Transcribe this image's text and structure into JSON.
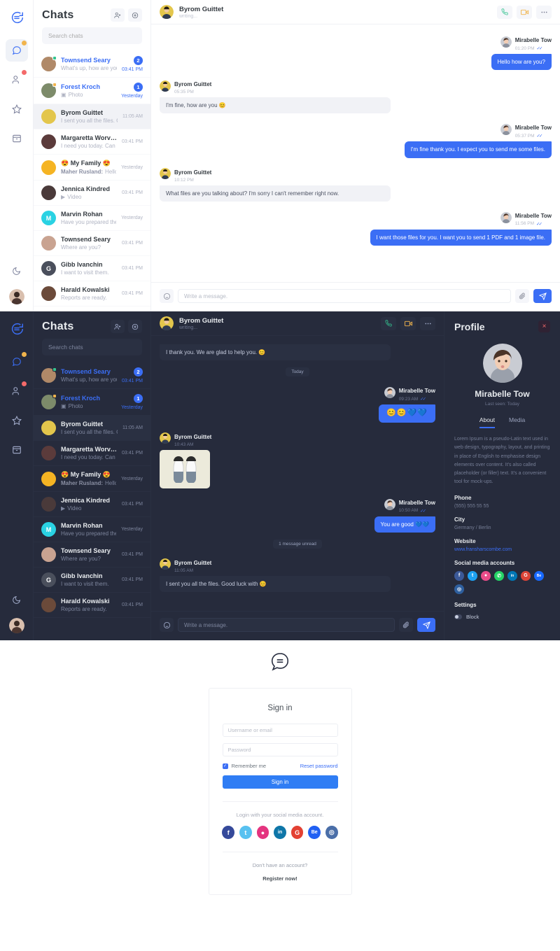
{
  "brand": {
    "accent": "#3b6ef5",
    "green": "#34c38f",
    "amber": "#f1b44c",
    "red": "#f46a6a"
  },
  "rail": {
    "items": [
      {
        "icon": "chat-logo-icon",
        "name": "app-logo"
      },
      {
        "icon": "chat-icon",
        "name": "rail-item-chats",
        "badge": "#f1b44c",
        "active": true
      },
      {
        "icon": "contacts-icon",
        "name": "rail-item-contacts",
        "badge": "#f46a6a",
        "active": false
      },
      {
        "icon": "star-icon",
        "name": "rail-item-favorites",
        "badge": "",
        "active": false
      },
      {
        "icon": "archive-icon",
        "name": "rail-item-archive",
        "badge": "",
        "active": false
      }
    ],
    "bottom": [
      {
        "icon": "moon-icon",
        "name": "rail-item-dark-mode"
      },
      {
        "icon": "avatar-icon",
        "name": "rail-item-profile"
      }
    ]
  },
  "list": {
    "title": "Chats",
    "action_add_label": "add-contact",
    "action_settings_label": "settings",
    "search_placeholder": "Search chats",
    "rows": [
      {
        "name": "Townsend Seary",
        "sub": "What's up, how are you?",
        "time": "03:41 PM",
        "badge": "2",
        "unread": true,
        "status": "#34c38f",
        "avatar": "#b08968",
        "initial": ""
      },
      {
        "name": "Forest Kroch",
        "sub": "Photo",
        "sub_icon": "camera-icon",
        "time": "Yesterday",
        "badge": "1",
        "unread": true,
        "status": "#f1b44c",
        "avatar": "#7d8b6a",
        "initial": ""
      },
      {
        "name": "Byrom Guittet",
        "sub": "I sent you all the files. G...",
        "time": "11:05 AM",
        "badge": "",
        "unread": false,
        "status": "",
        "avatar": "#e3c64c",
        "initial": "",
        "active": true
      },
      {
        "name": "Margaretta Worvell",
        "sub": "I need you today. Can y...",
        "time": "03:41 PM",
        "badge": "",
        "unread": false,
        "status": "",
        "avatar": "#5b3b3b",
        "initial": ""
      },
      {
        "name": "😍 My Family 😍",
        "sub_bold": "Maher Rusland:",
        "sub": "Hello!!!",
        "time": "Yesterday",
        "badge": "",
        "unread": false,
        "status": "",
        "avatar": "#f5b423",
        "initial": ""
      },
      {
        "name": "Jennica Kindred",
        "sub": "Video",
        "sub_icon": "video-icon",
        "time": "03:41 PM",
        "badge": "",
        "unread": false,
        "status": "",
        "avatar": "#4a3a3a",
        "initial": ""
      },
      {
        "name": "Marvin Rohan",
        "sub": "Have you prepared the ...",
        "time": "Yesterday",
        "badge": "",
        "unread": false,
        "status": "",
        "avatar": "#2ad2e3",
        "initial": "M"
      },
      {
        "name": "Townsend Seary",
        "sub": "Where are you?",
        "time": "03:41 PM",
        "badge": "",
        "unread": false,
        "status": "",
        "avatar": "#c9a391",
        "initial": ""
      },
      {
        "name": "Gibb Ivanchin",
        "sub": "I want to visit them.",
        "time": "03:41 PM",
        "badge": "",
        "unread": false,
        "status": "",
        "avatar": "#4a4f5c",
        "initial": "G"
      },
      {
        "name": "Harald Kowalski",
        "sub": "Reports are ready.",
        "time": "03:41 PM",
        "badge": "",
        "unread": false,
        "status": "",
        "avatar": "#6b4a3a",
        "initial": ""
      }
    ]
  },
  "convo_light": {
    "header": {
      "name": "Byrom Guittet",
      "state": "writing...",
      "call_label": "voice-call",
      "video_label": "video-call",
      "more_label": "more-options"
    },
    "messages": [
      {
        "dir": "out",
        "name": "Mirabelle Tow",
        "time": "01:20 PM",
        "ticks": "✓✓",
        "text": "Hello how are you?"
      },
      {
        "dir": "in",
        "name": "Byrom Guittet",
        "time": "05:35 PM",
        "text": "I'm fine, how are you 😊"
      },
      {
        "dir": "out",
        "name": "Mirabelle Tow",
        "time": "05:37 PM",
        "ticks": "✓✓",
        "text": "I'm fine thank you. I expect you to send me some files."
      },
      {
        "dir": "in",
        "name": "Byrom Guittet",
        "time": "10:12 PM",
        "text": "What files are you talking about? I'm sorry I can't remember right now."
      },
      {
        "dir": "out",
        "name": "Mirabelle Tow",
        "time": "11:56 PM",
        "ticks": "✓✓",
        "text": "I want those files for you. I want you to send 1 PDF and 1 image file."
      }
    ],
    "footer": {
      "emoji_label": "emoji-picker",
      "placeholder": "Write a message.",
      "attach_label": "attach-file",
      "send_label": "send-message"
    }
  },
  "convo_dark": {
    "header": {
      "name": "Byrom Guittet",
      "state": "writing...",
      "call_label": "voice-call",
      "video_label": "video-call",
      "more_label": "more-options"
    },
    "messages": [
      {
        "dir": "in",
        "text": "I thank you. We are glad to help you. 😊",
        "nometa": true
      },
      {
        "dir": "day",
        "text": "Today"
      },
      {
        "dir": "out",
        "name": "Mirabelle Tow",
        "time": "09:23 AM",
        "ticks": "✓✓",
        "text": "😊😊💙💙",
        "emoji": true
      },
      {
        "dir": "in",
        "name": "Byrom Guittet",
        "time": "10:43 AM",
        "image": true
      },
      {
        "dir": "out",
        "name": "Mirabelle Tow",
        "time": "10:50 AM",
        "ticks": "✓✓",
        "text": "You are good 💙💙"
      },
      {
        "dir": "day",
        "text": "1 message unread"
      },
      {
        "dir": "in",
        "name": "Byrom Guittet",
        "time": "11:05 AM",
        "text": "I sent you all the files. Good luck with 😊"
      }
    ],
    "footer": {
      "emoji_label": "emoji-picker",
      "placeholder": "Write a message.",
      "attach_label": "attach-file",
      "send_label": "send-message"
    }
  },
  "profile": {
    "title": "Profile",
    "close_label": "×",
    "name": "Mirabelle Tow",
    "last_seen": "Last seen: Today",
    "tabs": [
      {
        "label": "About",
        "active": true
      },
      {
        "label": "Media",
        "active": false
      }
    ],
    "about": "Lorem Ipsum is a pseudo-Latin text used in web design, typography, layout, and printing in place of English to emphasise design elements over content. It's also called placeholder (or filler) text. It's a convenient tool for mock-ups.",
    "phone_label": "Phone",
    "phone": "(555) 555 55 55",
    "city_label": "City",
    "city": "Germany / Berlin",
    "website_label": "Website",
    "website": "www.fransharscombe.com",
    "socials_label": "Social media accounts",
    "socials": [
      {
        "name": "facebook-icon",
        "glyph": "f",
        "color": "#3b5998"
      },
      {
        "name": "twitter-icon",
        "glyph": "t",
        "color": "#1da1f2"
      },
      {
        "name": "dribbble-icon",
        "glyph": "●",
        "color": "#ea4c89"
      },
      {
        "name": "whatsapp-icon",
        "glyph": "✆",
        "color": "#25d366"
      },
      {
        "name": "linkedin-icon",
        "glyph": "in",
        "color": "#0077b5"
      },
      {
        "name": "google-icon",
        "glyph": "G",
        "color": "#db4437"
      },
      {
        "name": "behance-icon",
        "glyph": "Be",
        "color": "#1769ff"
      },
      {
        "name": "instagram-icon",
        "glyph": "◎",
        "color": "#2e5f9e"
      }
    ],
    "settings_label": "Settings",
    "block_label": "Block"
  },
  "signin": {
    "logo_label": "chat-logo-icon",
    "title": "Sign in",
    "username_placeholder": "Username or email",
    "password_placeholder": "Password",
    "remember_label": "Remember me",
    "reset_label": "Reset password",
    "submit_label": "Sign in",
    "social_hint": "Login with your social media account.",
    "socials": [
      {
        "name": "facebook-icon",
        "glyph": "f",
        "color": "#35499a"
      },
      {
        "name": "twitter-icon",
        "glyph": "t",
        "color": "#58c1f0"
      },
      {
        "name": "dribbble-icon",
        "glyph": "●",
        "color": "#e4347f"
      },
      {
        "name": "linkedin-icon",
        "glyph": "in",
        "color": "#0e76a8"
      },
      {
        "name": "google-icon",
        "glyph": "G",
        "color": "#e34133"
      },
      {
        "name": "behance-icon",
        "glyph": "Be",
        "color": "#2160f3"
      },
      {
        "name": "instagram-icon",
        "glyph": "◎",
        "color": "#4a6ea8"
      }
    ],
    "no_account": "Don't have an account?",
    "register_label": "Register now!"
  }
}
